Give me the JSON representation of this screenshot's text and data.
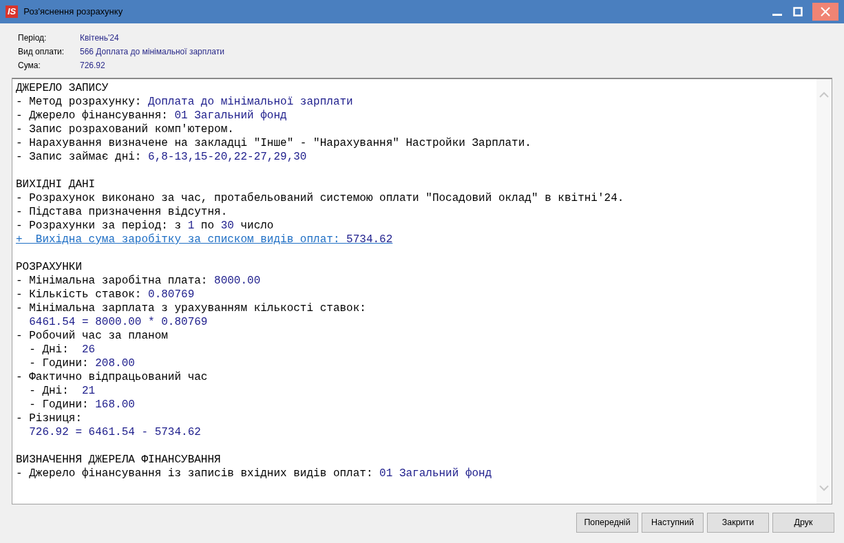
{
  "window": {
    "title": "Роз'яснення розрахунку",
    "logo": "IS"
  },
  "info": [
    {
      "label": "Період:",
      "value": "Квітень'24"
    },
    {
      "label": "Вид оплати:",
      "value": "566 Доплата до мінімальної зарплати"
    },
    {
      "label": "Сума:",
      "value": "726.92"
    }
  ],
  "report": [
    {
      "heading": "ДЖЕРЕЛО ЗАПИСУ",
      "lines": [
        {
          "kind": "text",
          "parts": [
            {
              "kind": "label",
              "text": "- Метод розрахунку: "
            },
            {
              "kind": "value",
              "text": "Доплата до мінімальної зарплати"
            }
          ]
        },
        {
          "kind": "text",
          "parts": [
            {
              "kind": "label",
              "text": "- Джерело фінансування: "
            },
            {
              "kind": "value",
              "text": "01 Загальний фонд"
            }
          ]
        },
        {
          "kind": "text",
          "parts": [
            {
              "kind": "label",
              "text": "- Запис розрахований комп'ютером."
            }
          ]
        },
        {
          "kind": "text",
          "parts": [
            {
              "kind": "label",
              "text": "- Нарахування визначене на закладці \"Інше\" - \"Нарахування\" Настройки Зарплати."
            }
          ]
        },
        {
          "kind": "text",
          "parts": [
            {
              "kind": "label",
              "text": "- Запис займає дні: "
            },
            {
              "kind": "value",
              "text": "6,8-13,15-20,22-27,29,30"
            }
          ]
        }
      ]
    },
    {
      "heading": "ВИХІДНІ ДАНІ",
      "lines": [
        {
          "kind": "text",
          "parts": [
            {
              "kind": "label",
              "text": "- Розрахунок виконано за час, протабельований системою оплати \"Посадовий оклад\" в квітні'24."
            }
          ]
        },
        {
          "kind": "text",
          "parts": [
            {
              "kind": "label",
              "text": "- Підстава призначення відсутня."
            }
          ]
        },
        {
          "kind": "text",
          "parts": [
            {
              "kind": "label",
              "text": "- Розрахунки за період: з "
            },
            {
              "kind": "value",
              "text": "1"
            },
            {
              "kind": "label",
              "text": " по "
            },
            {
              "kind": "value",
              "text": "30"
            },
            {
              "kind": "label",
              "text": " число"
            }
          ]
        },
        {
          "kind": "link",
          "parts": [
            {
              "kind": "label",
              "text": "+  Вихідна сума заробітку за списком видів оплат: "
            },
            {
              "kind": "value",
              "text": "5734.62"
            }
          ]
        }
      ]
    },
    {
      "heading": "РОЗРАХУНКИ",
      "lines": [
        {
          "kind": "text",
          "parts": [
            {
              "kind": "label",
              "text": "- Мінімальна заробітна плата: "
            },
            {
              "kind": "value",
              "text": "8000.00"
            }
          ]
        },
        {
          "kind": "text",
          "parts": [
            {
              "kind": "label",
              "text": "- Кількість ставок: "
            },
            {
              "kind": "value",
              "text": "0.80769"
            }
          ]
        },
        {
          "kind": "text",
          "parts": [
            {
              "kind": "label",
              "text": "- Мінімальна зарплата з урахуванням кількості ставок:"
            }
          ],
          "children": [
            {
              "kind": "text",
              "parts": [
                {
                  "kind": "value",
                  "text": "6461.54 = 8000.00 * 0.80769"
                }
              ]
            }
          ]
        },
        {
          "kind": "text",
          "parts": [
            {
              "kind": "label",
              "text": "- Робочий час за планом"
            }
          ],
          "children": [
            {
              "kind": "text",
              "parts": [
                {
                  "kind": "label",
                  "text": "- Дні:  "
                },
                {
                  "kind": "value",
                  "text": "26"
                }
              ]
            },
            {
              "kind": "text",
              "parts": [
                {
                  "kind": "label",
                  "text": "- Години: "
                },
                {
                  "kind": "value",
                  "text": "208.00"
                }
              ]
            }
          ]
        },
        {
          "kind": "text",
          "parts": [
            {
              "kind": "label",
              "text": "- Фактично відпрацьований час"
            }
          ],
          "children": [
            {
              "kind": "text",
              "parts": [
                {
                  "kind": "label",
                  "text": "- Дні:  "
                },
                {
                  "kind": "value",
                  "text": "21"
                }
              ]
            },
            {
              "kind": "text",
              "parts": [
                {
                  "kind": "label",
                  "text": "- Години: "
                },
                {
                  "kind": "value",
                  "text": "168.00"
                }
              ]
            }
          ]
        },
        {
          "kind": "text",
          "parts": [
            {
              "kind": "label",
              "text": "- Різниця:"
            }
          ],
          "children": [
            {
              "kind": "text",
              "parts": [
                {
                  "kind": "value",
                  "text": "726.92 = 6461.54 - 5734.62"
                }
              ]
            }
          ]
        }
      ]
    },
    {
      "heading": "ВИЗНАЧЕННЯ ДЖЕРЕЛА ФІНАНСУВАННЯ",
      "lines": [
        {
          "kind": "text",
          "parts": [
            {
              "kind": "label",
              "text": "- Джерело фінансування із записів вхідних видів оплат: "
            },
            {
              "kind": "value",
              "text": "01 Загальний фонд"
            }
          ]
        }
      ]
    }
  ],
  "buttons": [
    "Попередній",
    "Наступний",
    "Закрити",
    "Друк"
  ]
}
